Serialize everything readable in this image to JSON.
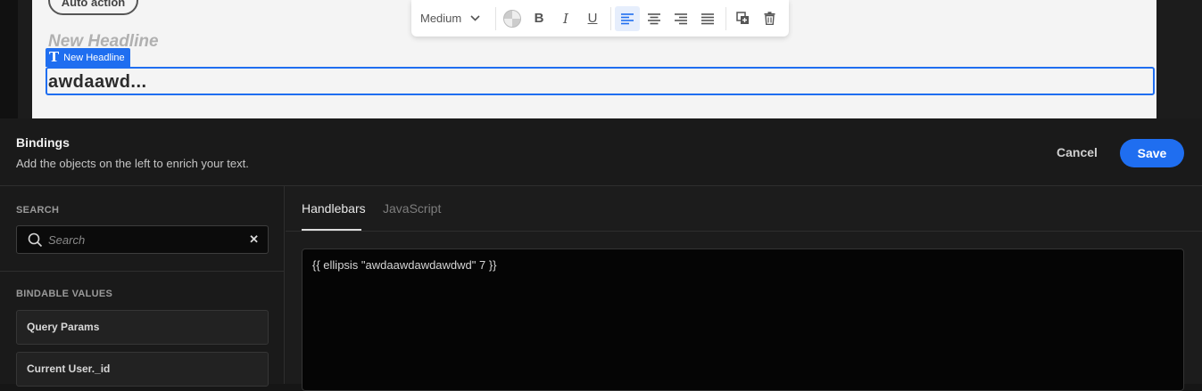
{
  "canvas": {
    "auto_action_label": "Auto action",
    "ghost_headline": "New Headline",
    "selected_component_label": "New Headline",
    "headline_text": "awdaawd..."
  },
  "toolbar": {
    "font_weight_value": "Medium",
    "icons": [
      "color-picker-icon",
      "bold-icon",
      "italic-icon",
      "underline-icon",
      "align-left-icon",
      "align-center-icon",
      "align-right-icon",
      "align-justify-icon",
      "duplicate-icon",
      "trash-icon"
    ],
    "active_alignment": "left"
  },
  "bindings": {
    "title": "Bindings",
    "subtitle": "Add the objects on the left to enrich your text.",
    "cancel_label": "Cancel",
    "save_label": "Save"
  },
  "sidebar": {
    "search_label": "SEARCH",
    "search_placeholder": "Search",
    "bindable_label": "BINDABLE VALUES",
    "items": [
      {
        "label": "Query Params"
      },
      {
        "label": "Current User._id"
      }
    ]
  },
  "editor": {
    "tabs": [
      {
        "label": "Handlebars",
        "active": true
      },
      {
        "label": "JavaScript",
        "active": false
      }
    ],
    "code": "{{ ellipsis \"awdaawdawdawdwd\" 7 }}"
  },
  "colors": {
    "accent": "#1f6ef0",
    "panel_bg": "#1a1a1a",
    "code_bg": "#050505"
  }
}
